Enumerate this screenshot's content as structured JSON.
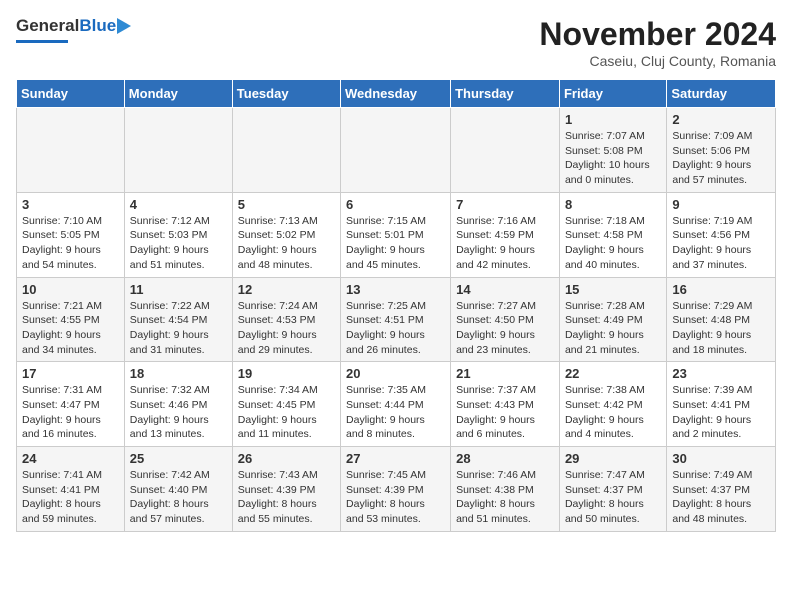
{
  "header": {
    "logo_line1": "General",
    "logo_line2": "Blue",
    "title": "November 2024",
    "subtitle": "Caseiu, Cluj County, Romania"
  },
  "days_of_week": [
    "Sunday",
    "Monday",
    "Tuesday",
    "Wednesday",
    "Thursday",
    "Friday",
    "Saturday"
  ],
  "weeks": [
    [
      {
        "day": "",
        "info": ""
      },
      {
        "day": "",
        "info": ""
      },
      {
        "day": "",
        "info": ""
      },
      {
        "day": "",
        "info": ""
      },
      {
        "day": "",
        "info": ""
      },
      {
        "day": "1",
        "info": "Sunrise: 7:07 AM\nSunset: 5:08 PM\nDaylight: 10 hours\nand 0 minutes."
      },
      {
        "day": "2",
        "info": "Sunrise: 7:09 AM\nSunset: 5:06 PM\nDaylight: 9 hours\nand 57 minutes."
      }
    ],
    [
      {
        "day": "3",
        "info": "Sunrise: 7:10 AM\nSunset: 5:05 PM\nDaylight: 9 hours\nand 54 minutes."
      },
      {
        "day": "4",
        "info": "Sunrise: 7:12 AM\nSunset: 5:03 PM\nDaylight: 9 hours\nand 51 minutes."
      },
      {
        "day": "5",
        "info": "Sunrise: 7:13 AM\nSunset: 5:02 PM\nDaylight: 9 hours\nand 48 minutes."
      },
      {
        "day": "6",
        "info": "Sunrise: 7:15 AM\nSunset: 5:01 PM\nDaylight: 9 hours\nand 45 minutes."
      },
      {
        "day": "7",
        "info": "Sunrise: 7:16 AM\nSunset: 4:59 PM\nDaylight: 9 hours\nand 42 minutes."
      },
      {
        "day": "8",
        "info": "Sunrise: 7:18 AM\nSunset: 4:58 PM\nDaylight: 9 hours\nand 40 minutes."
      },
      {
        "day": "9",
        "info": "Sunrise: 7:19 AM\nSunset: 4:56 PM\nDaylight: 9 hours\nand 37 minutes."
      }
    ],
    [
      {
        "day": "10",
        "info": "Sunrise: 7:21 AM\nSunset: 4:55 PM\nDaylight: 9 hours\nand 34 minutes."
      },
      {
        "day": "11",
        "info": "Sunrise: 7:22 AM\nSunset: 4:54 PM\nDaylight: 9 hours\nand 31 minutes."
      },
      {
        "day": "12",
        "info": "Sunrise: 7:24 AM\nSunset: 4:53 PM\nDaylight: 9 hours\nand 29 minutes."
      },
      {
        "day": "13",
        "info": "Sunrise: 7:25 AM\nSunset: 4:51 PM\nDaylight: 9 hours\nand 26 minutes."
      },
      {
        "day": "14",
        "info": "Sunrise: 7:27 AM\nSunset: 4:50 PM\nDaylight: 9 hours\nand 23 minutes."
      },
      {
        "day": "15",
        "info": "Sunrise: 7:28 AM\nSunset: 4:49 PM\nDaylight: 9 hours\nand 21 minutes."
      },
      {
        "day": "16",
        "info": "Sunrise: 7:29 AM\nSunset: 4:48 PM\nDaylight: 9 hours\nand 18 minutes."
      }
    ],
    [
      {
        "day": "17",
        "info": "Sunrise: 7:31 AM\nSunset: 4:47 PM\nDaylight: 9 hours\nand 16 minutes."
      },
      {
        "day": "18",
        "info": "Sunrise: 7:32 AM\nSunset: 4:46 PM\nDaylight: 9 hours\nand 13 minutes."
      },
      {
        "day": "19",
        "info": "Sunrise: 7:34 AM\nSunset: 4:45 PM\nDaylight: 9 hours\nand 11 minutes."
      },
      {
        "day": "20",
        "info": "Sunrise: 7:35 AM\nSunset: 4:44 PM\nDaylight: 9 hours\nand 8 minutes."
      },
      {
        "day": "21",
        "info": "Sunrise: 7:37 AM\nSunset: 4:43 PM\nDaylight: 9 hours\nand 6 minutes."
      },
      {
        "day": "22",
        "info": "Sunrise: 7:38 AM\nSunset: 4:42 PM\nDaylight: 9 hours\nand 4 minutes."
      },
      {
        "day": "23",
        "info": "Sunrise: 7:39 AM\nSunset: 4:41 PM\nDaylight: 9 hours\nand 2 minutes."
      }
    ],
    [
      {
        "day": "24",
        "info": "Sunrise: 7:41 AM\nSunset: 4:41 PM\nDaylight: 8 hours\nand 59 minutes."
      },
      {
        "day": "25",
        "info": "Sunrise: 7:42 AM\nSunset: 4:40 PM\nDaylight: 8 hours\nand 57 minutes."
      },
      {
        "day": "26",
        "info": "Sunrise: 7:43 AM\nSunset: 4:39 PM\nDaylight: 8 hours\nand 55 minutes."
      },
      {
        "day": "27",
        "info": "Sunrise: 7:45 AM\nSunset: 4:39 PM\nDaylight: 8 hours\nand 53 minutes."
      },
      {
        "day": "28",
        "info": "Sunrise: 7:46 AM\nSunset: 4:38 PM\nDaylight: 8 hours\nand 51 minutes."
      },
      {
        "day": "29",
        "info": "Sunrise: 7:47 AM\nSunset: 4:37 PM\nDaylight: 8 hours\nand 50 minutes."
      },
      {
        "day": "30",
        "info": "Sunrise: 7:49 AM\nSunset: 4:37 PM\nDaylight: 8 hours\nand 48 minutes."
      }
    ]
  ]
}
